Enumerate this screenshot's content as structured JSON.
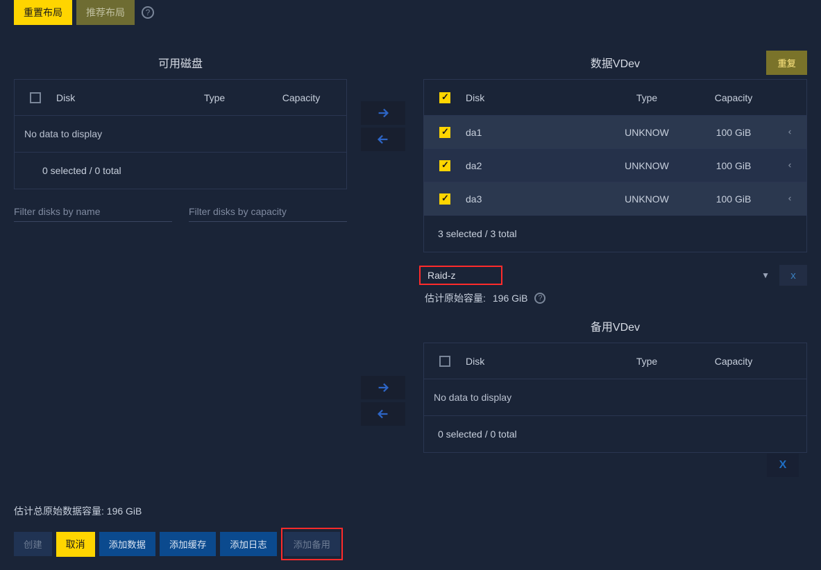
{
  "top": {
    "reset_layout": "重置布局",
    "suggest_layout": "推荐布局"
  },
  "available": {
    "title": "可用磁盘",
    "col_disk": "Disk",
    "col_type": "Type",
    "col_capacity": "Capacity",
    "no_data": "No data to display",
    "footer": "0 selected / 0 total",
    "filter_name_placeholder": "Filter disks by name",
    "filter_cap_placeholder": "Filter disks by capacity"
  },
  "data_vdev": {
    "title": "数据VDev",
    "revert": "重复",
    "col_disk": "Disk",
    "col_type": "Type",
    "col_capacity": "Capacity",
    "rows": [
      {
        "disk": "da1",
        "type": "UNKNOW",
        "capacity": "100 GiB"
      },
      {
        "disk": "da2",
        "type": "UNKNOW",
        "capacity": "100 GiB"
      },
      {
        "disk": "da3",
        "type": "UNKNOW",
        "capacity": "100 GiB"
      }
    ],
    "footer": "3 selected / 3 total",
    "raid_value": "Raid-z",
    "est_label": "估计原始容量:",
    "est_value": "196 GiB",
    "remove_x": "x"
  },
  "spare_vdev": {
    "title": "备用VDev",
    "col_disk": "Disk",
    "col_type": "Type",
    "col_capacity": "Capacity",
    "no_data": "No data to display",
    "footer": "0 selected / 0 total",
    "remove_x": "X"
  },
  "total_estimate": "估计总原始数据容量: 196 GiB",
  "actions": {
    "create": "创建",
    "cancel": "取消",
    "add_data": "添加数据",
    "add_cache": "添加缓存",
    "add_log": "添加日志",
    "add_spare": "添加备用"
  }
}
